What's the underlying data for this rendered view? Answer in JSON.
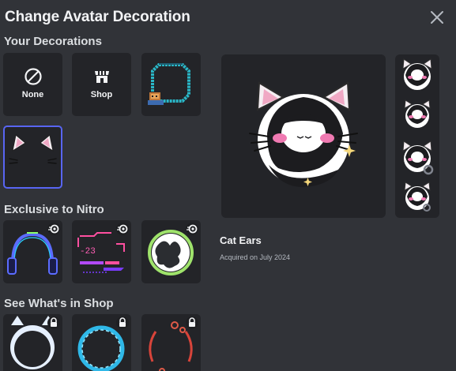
{
  "dialog": {
    "title": "Change Avatar Decoration"
  },
  "sections": {
    "your_decorations": "Your Decorations",
    "exclusive_nitro": "Exclusive to Nitro",
    "shop": "See What's in Shop"
  },
  "your_decorations": {
    "none_label": "None",
    "shop_label": "Shop"
  },
  "selected": {
    "name": "Cat Ears",
    "acquired": "Acquired on July 2024"
  },
  "colors": {
    "background": "#313338",
    "tile": "#232428",
    "accent": "#5865f2"
  },
  "icons": {
    "close": "close-icon",
    "none": "no-entry-icon",
    "shop": "store-icon",
    "nitro": "nitro-icon",
    "lock": "lock-icon"
  }
}
